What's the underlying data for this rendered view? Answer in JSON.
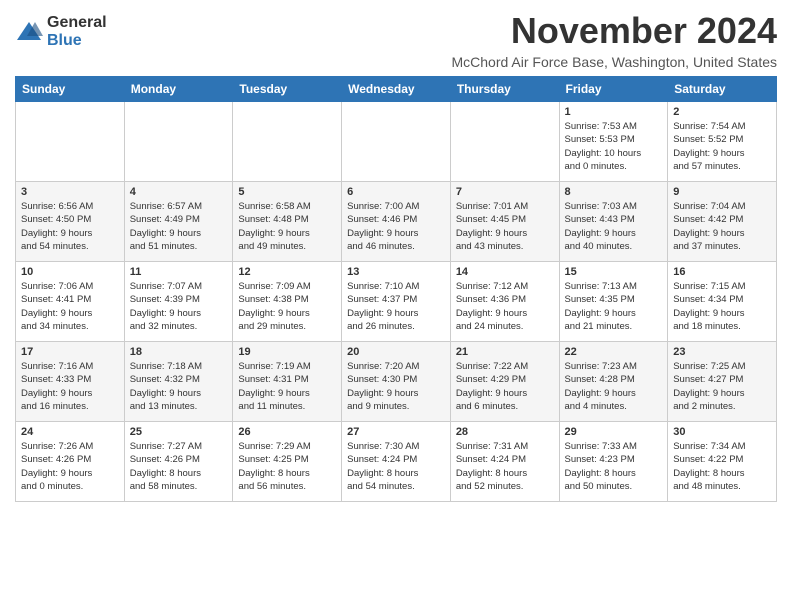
{
  "header": {
    "logo_general": "General",
    "logo_blue": "Blue",
    "month_title": "November 2024",
    "location": "McChord Air Force Base, Washington, United States"
  },
  "calendar": {
    "days_of_week": [
      "Sunday",
      "Monday",
      "Tuesday",
      "Wednesday",
      "Thursday",
      "Friday",
      "Saturday"
    ],
    "weeks": [
      [
        {
          "day": "",
          "info": ""
        },
        {
          "day": "",
          "info": ""
        },
        {
          "day": "",
          "info": ""
        },
        {
          "day": "",
          "info": ""
        },
        {
          "day": "",
          "info": ""
        },
        {
          "day": "1",
          "info": "Sunrise: 7:53 AM\nSunset: 5:53 PM\nDaylight: 10 hours\nand 0 minutes."
        },
        {
          "day": "2",
          "info": "Sunrise: 7:54 AM\nSunset: 5:52 PM\nDaylight: 9 hours\nand 57 minutes."
        }
      ],
      [
        {
          "day": "3",
          "info": "Sunrise: 6:56 AM\nSunset: 4:50 PM\nDaylight: 9 hours\nand 54 minutes."
        },
        {
          "day": "4",
          "info": "Sunrise: 6:57 AM\nSunset: 4:49 PM\nDaylight: 9 hours\nand 51 minutes."
        },
        {
          "day": "5",
          "info": "Sunrise: 6:58 AM\nSunset: 4:48 PM\nDaylight: 9 hours\nand 49 minutes."
        },
        {
          "day": "6",
          "info": "Sunrise: 7:00 AM\nSunset: 4:46 PM\nDaylight: 9 hours\nand 46 minutes."
        },
        {
          "day": "7",
          "info": "Sunrise: 7:01 AM\nSunset: 4:45 PM\nDaylight: 9 hours\nand 43 minutes."
        },
        {
          "day": "8",
          "info": "Sunrise: 7:03 AM\nSunset: 4:43 PM\nDaylight: 9 hours\nand 40 minutes."
        },
        {
          "day": "9",
          "info": "Sunrise: 7:04 AM\nSunset: 4:42 PM\nDaylight: 9 hours\nand 37 minutes."
        }
      ],
      [
        {
          "day": "10",
          "info": "Sunrise: 7:06 AM\nSunset: 4:41 PM\nDaylight: 9 hours\nand 34 minutes."
        },
        {
          "day": "11",
          "info": "Sunrise: 7:07 AM\nSunset: 4:39 PM\nDaylight: 9 hours\nand 32 minutes."
        },
        {
          "day": "12",
          "info": "Sunrise: 7:09 AM\nSunset: 4:38 PM\nDaylight: 9 hours\nand 29 minutes."
        },
        {
          "day": "13",
          "info": "Sunrise: 7:10 AM\nSunset: 4:37 PM\nDaylight: 9 hours\nand 26 minutes."
        },
        {
          "day": "14",
          "info": "Sunrise: 7:12 AM\nSunset: 4:36 PM\nDaylight: 9 hours\nand 24 minutes."
        },
        {
          "day": "15",
          "info": "Sunrise: 7:13 AM\nSunset: 4:35 PM\nDaylight: 9 hours\nand 21 minutes."
        },
        {
          "day": "16",
          "info": "Sunrise: 7:15 AM\nSunset: 4:34 PM\nDaylight: 9 hours\nand 18 minutes."
        }
      ],
      [
        {
          "day": "17",
          "info": "Sunrise: 7:16 AM\nSunset: 4:33 PM\nDaylight: 9 hours\nand 16 minutes."
        },
        {
          "day": "18",
          "info": "Sunrise: 7:18 AM\nSunset: 4:32 PM\nDaylight: 9 hours\nand 13 minutes."
        },
        {
          "day": "19",
          "info": "Sunrise: 7:19 AM\nSunset: 4:31 PM\nDaylight: 9 hours\nand 11 minutes."
        },
        {
          "day": "20",
          "info": "Sunrise: 7:20 AM\nSunset: 4:30 PM\nDaylight: 9 hours\nand 9 minutes."
        },
        {
          "day": "21",
          "info": "Sunrise: 7:22 AM\nSunset: 4:29 PM\nDaylight: 9 hours\nand 6 minutes."
        },
        {
          "day": "22",
          "info": "Sunrise: 7:23 AM\nSunset: 4:28 PM\nDaylight: 9 hours\nand 4 minutes."
        },
        {
          "day": "23",
          "info": "Sunrise: 7:25 AM\nSunset: 4:27 PM\nDaylight: 9 hours\nand 2 minutes."
        }
      ],
      [
        {
          "day": "24",
          "info": "Sunrise: 7:26 AM\nSunset: 4:26 PM\nDaylight: 9 hours\nand 0 minutes."
        },
        {
          "day": "25",
          "info": "Sunrise: 7:27 AM\nSunset: 4:26 PM\nDaylight: 8 hours\nand 58 minutes."
        },
        {
          "day": "26",
          "info": "Sunrise: 7:29 AM\nSunset: 4:25 PM\nDaylight: 8 hours\nand 56 minutes."
        },
        {
          "day": "27",
          "info": "Sunrise: 7:30 AM\nSunset: 4:24 PM\nDaylight: 8 hours\nand 54 minutes."
        },
        {
          "day": "28",
          "info": "Sunrise: 7:31 AM\nSunset: 4:24 PM\nDaylight: 8 hours\nand 52 minutes."
        },
        {
          "day": "29",
          "info": "Sunrise: 7:33 AM\nSunset: 4:23 PM\nDaylight: 8 hours\nand 50 minutes."
        },
        {
          "day": "30",
          "info": "Sunrise: 7:34 AM\nSunset: 4:22 PM\nDaylight: 8 hours\nand 48 minutes."
        }
      ]
    ]
  }
}
